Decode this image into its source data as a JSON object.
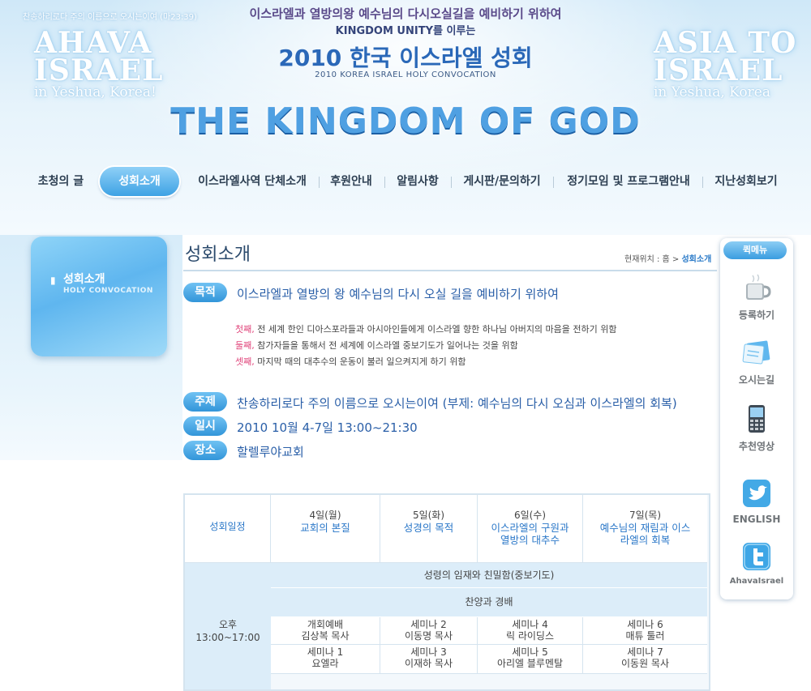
{
  "header": {
    "verse": "찬송하리로다 주의 이름으로 오시는이여 (마23:39)",
    "logo_left_line1": "AHAVA",
    "logo_left_line2": "ISRAEL",
    "logo_left_line3": "in Yeshua, Korea!",
    "logo_right_line1": "ASIA TO",
    "logo_right_line2": "ISRAEL",
    "logo_right_line3": "in Yeshua, Korea",
    "tagline1": "이스라엘과 열방의왕 예수님의 다시오실길을 예비하기 위하여",
    "tagline2": "KINGDOM UNITY를 이루는",
    "title": "2010 한국 이스라엘 성회",
    "subtitle": "2010 KOREA ISRAEL HOLY CONVOCATION",
    "banner": "THE KINGDOM OF GOD"
  },
  "nav": {
    "items": [
      {
        "label": "초청의 글"
      },
      {
        "label": "성회소개"
      },
      {
        "label": "이스라엘사역 단체소개"
      },
      {
        "label": "후원안내"
      },
      {
        "label": "알림사항"
      },
      {
        "label": "게시판/문의하기"
      },
      {
        "label": "정기모임 및 프로그램안내"
      },
      {
        "label": "지난성회보기"
      }
    ],
    "active_index": 1
  },
  "sidebar": {
    "title": "성회소개",
    "subtitle": "HOLY CONVOCATION"
  },
  "main": {
    "page_title": "성회소개",
    "breadcrumb_prefix": "현재위치 : 홈 > ",
    "breadcrumb_current": "성회소개",
    "purpose_label": "목적",
    "purpose_text": "이스라엘과 열방의 왕 예수님의 다시 오실 길을 예비하기 위하여",
    "purpose_points": [
      {
        "num": "첫째,",
        "text": " 전 세계 한인 디아스포라들과 아시아인들에게 이스라엘 향한 하나님 아버지의 마음을 전하기 위함"
      },
      {
        "num": "둘째,",
        "text": " 참가자들을 통해서 전 세계에 이스라엘 중보기도가 일어나는 것을 위함"
      },
      {
        "num": "셋째,",
        "text": " 마지막 때의 대추수의 운동이 불러 일으켜지게 하기 위함"
      }
    ],
    "theme_label": "주제",
    "theme_text": "찬송하리로다 주의 이름으로 오시는이여 (부제: 예수님의 다시 오심과 이스라엘의 회복)",
    "date_label": "일시",
    "date_text": "2010 10월 4-7일 13:00~21:30",
    "place_label": "장소",
    "place_text": "할렐루야교회"
  },
  "schedule": {
    "corner": "성회일정",
    "days": [
      {
        "date": "4일(월)",
        "theme": "교회의 본질"
      },
      {
        "date": "5일(화)",
        "theme": "성경의 목적"
      },
      {
        "date": "6일(수)",
        "theme": "이스라엘의 구원과 열방의 대추수"
      },
      {
        "date": "7일(목)",
        "theme": "예수님의 재림과 이스라엘의 회복"
      }
    ],
    "afternoon_label": "오후",
    "afternoon_time": "13:00~17:00",
    "band1": "성령의 임재와 친밀함(중보기도)",
    "band2": "찬양과 경배",
    "row1": [
      {
        "title": "개회예배",
        "speaker": "김상복 목사"
      },
      {
        "title": "세미나 2",
        "speaker": "이동명 목사"
      },
      {
        "title": "세미나 4",
        "speaker": "릭 라이딩스"
      },
      {
        "title": "세미나 6",
        "speaker": "매튜 툴러"
      }
    ],
    "row2": [
      {
        "title": "세미나 1",
        "speaker": "요엘라"
      },
      {
        "title": "세미나 3",
        "speaker": "이재하 목사"
      },
      {
        "title": "세미나 5",
        "speaker": "아리엘 블루멘탈"
      },
      {
        "title": "세미나 7",
        "speaker": "이동원 목사"
      }
    ]
  },
  "quickmenu": {
    "title": "퀵메뉴",
    "items": [
      {
        "label": "등록하기",
        "icon": "cup-icon"
      },
      {
        "label": "오시는길",
        "icon": "map-icon"
      },
      {
        "label": "추천영상",
        "icon": "phone-icon"
      },
      {
        "label": "ENGLISH",
        "icon": "bird-icon"
      },
      {
        "label": "AhavaIsrael",
        "icon": "twitter-icon"
      }
    ]
  },
  "colors": {
    "accent": "#3a9de0",
    "title_blue": "#2a5fa8",
    "highlight_pink": "#e0447a"
  }
}
